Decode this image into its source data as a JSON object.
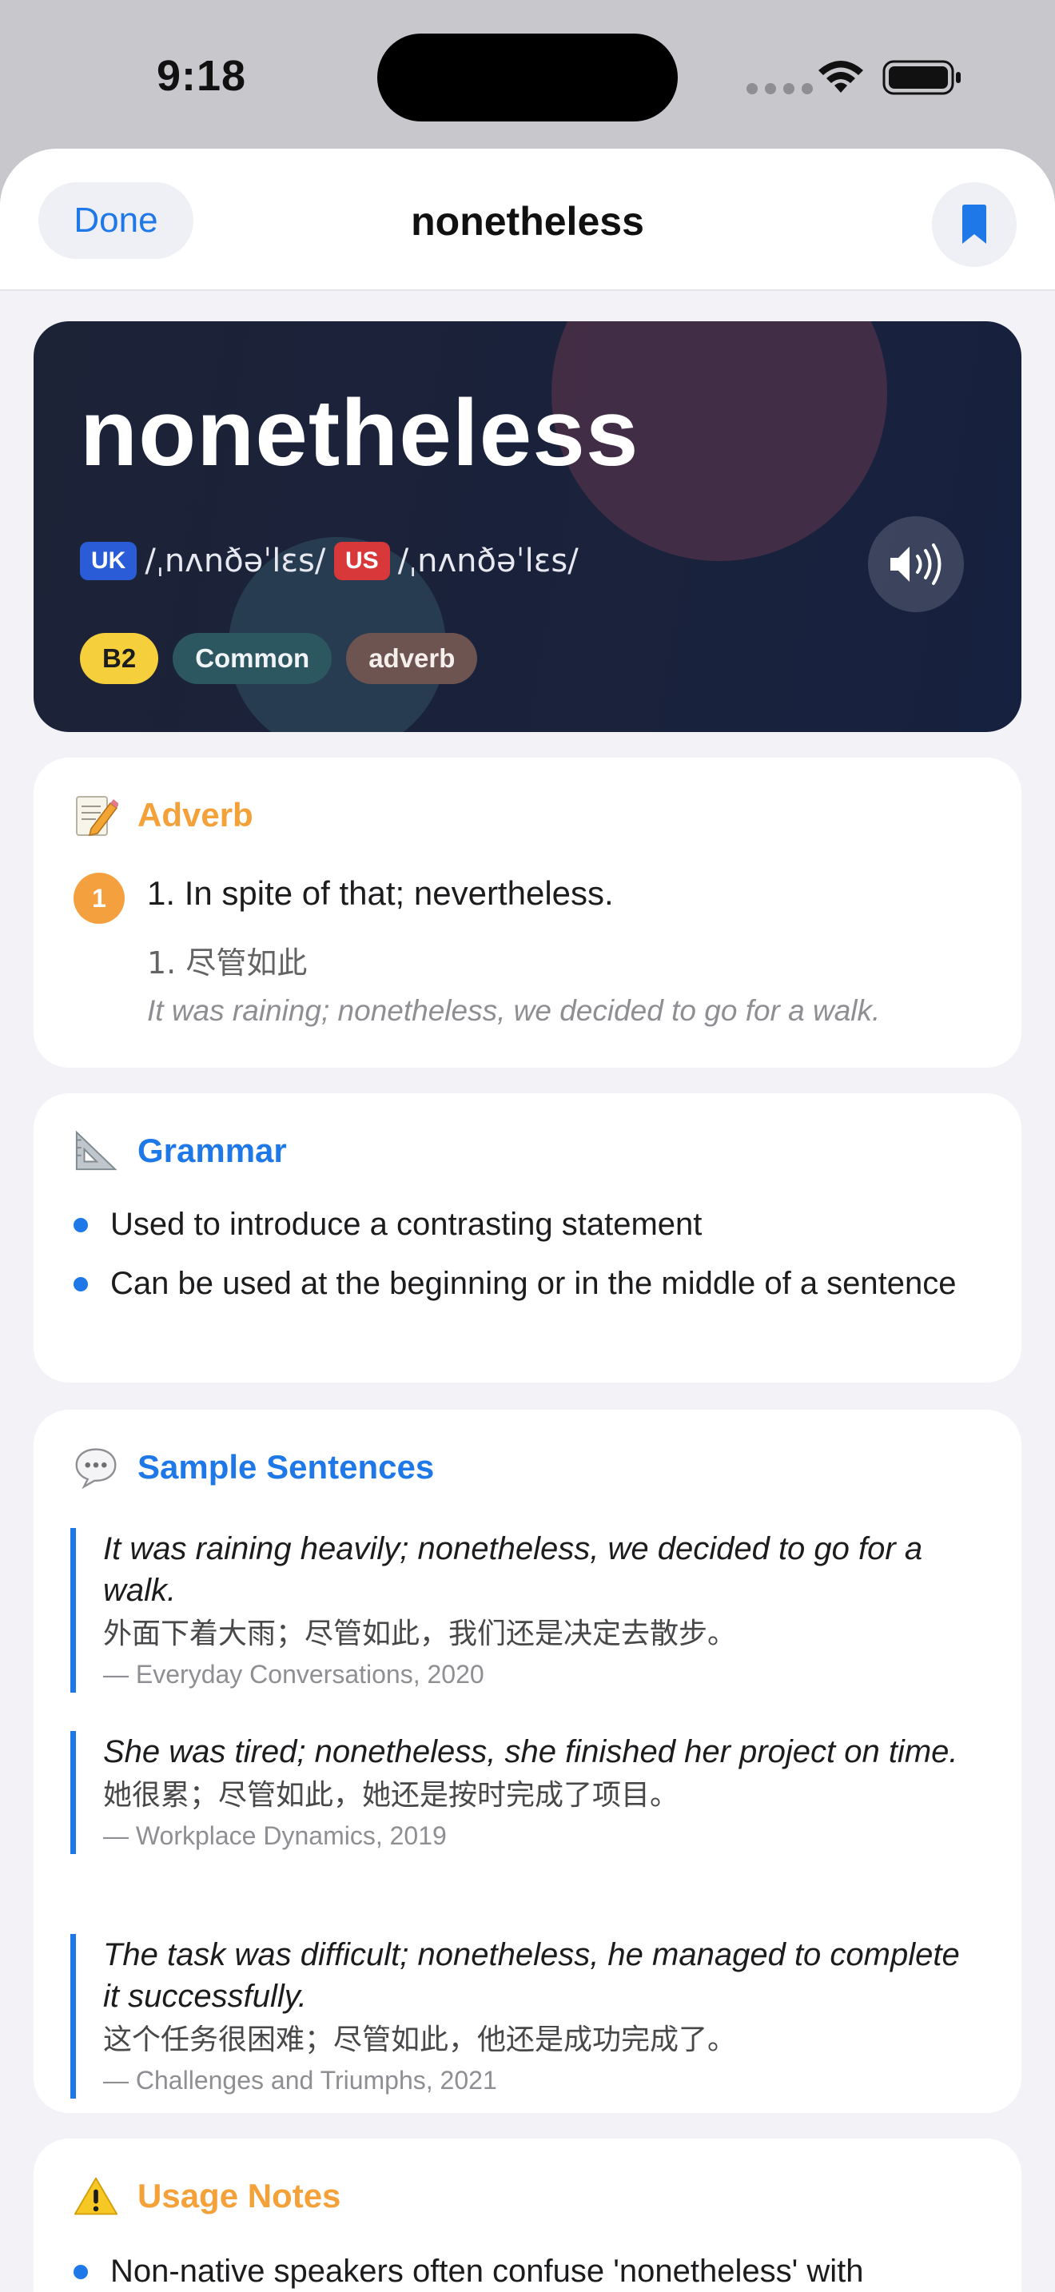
{
  "status_bar": {
    "time": "9:18"
  },
  "navbar": {
    "done_label": "Done",
    "title": "nonetheless"
  },
  "hero": {
    "word": "nonetheless",
    "uk_label": "UK",
    "uk_ipa": "/ˌnʌnðəˈlɛs/",
    "us_label": "US",
    "us_ipa": "/ˌnʌnðəˈlɛs/",
    "tags": {
      "level": "B2",
      "frequency": "Common",
      "pos": "adverb"
    }
  },
  "definition": {
    "title": "Adverb",
    "number": "1",
    "english": "1. In spite of that; nevertheless.",
    "chinese": "1. 尽管如此",
    "example": "It was raining; nonetheless, we decided to go for a walk."
  },
  "grammar": {
    "title": "Grammar",
    "items": [
      "Used to introduce a contrasting statement",
      "Can be used at the beginning or in the middle of a sentence"
    ]
  },
  "sentences": {
    "title": "Sample Sentences",
    "items": [
      {
        "en": "It was raining heavily; nonetheless, we decided to go for a walk.",
        "zh": "外面下着大雨；尽管如此，我们还是决定去散步。",
        "source": "— Everyday Conversations, 2020"
      },
      {
        "en": "She was tired; nonetheless, she finished her project on time.",
        "zh": "她很累；尽管如此，她还是按时完成了项目。",
        "source": "— Workplace Dynamics, 2019"
      },
      {
        "en": "The task was difficult; nonetheless, he managed to complete it successfully.",
        "zh": "这个任务很困难；尽管如此，他还是成功完成了。",
        "source": "— Challenges and Triumphs, 2021"
      }
    ]
  },
  "usage": {
    "title": "Usage Notes",
    "first_item": "Non-native speakers often confuse 'nonetheless' with"
  },
  "colors": {
    "accent_blue": "#1f78e8",
    "accent_orange": "#f4a13a",
    "hero_bg": "#1c2337",
    "level_tag": "#f6cf3c"
  }
}
